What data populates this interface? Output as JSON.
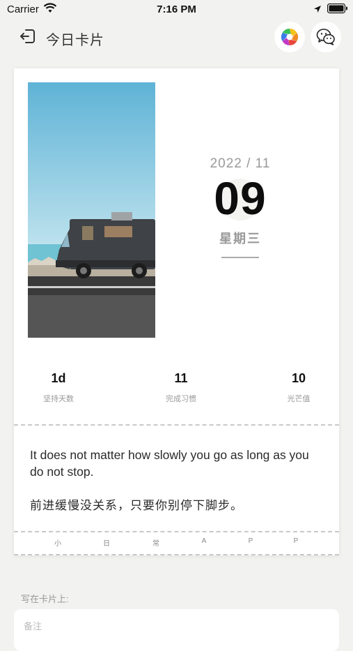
{
  "status_bar": {
    "carrier": "Carrier",
    "time": "7:16 PM"
  },
  "nav": {
    "title": "今日卡片"
  },
  "card": {
    "year_month": "2022 / 11",
    "day": "09",
    "weekday": "星期三",
    "stats": [
      {
        "value": "1d",
        "label": "坚持天数"
      },
      {
        "value": "11",
        "label": "完成习惯"
      },
      {
        "value": "10",
        "label": "光芒值"
      }
    ],
    "quote_en": "It does not matter how slowly you go as long as you do not stop.",
    "quote_zh": "前进缓慢没关系，只要你别停下脚步。",
    "brand_letters": [
      "小",
      "日",
      "常",
      "A",
      "P",
      "P"
    ]
  },
  "note": {
    "label": "写在卡片上:",
    "placeholder": "备注"
  }
}
